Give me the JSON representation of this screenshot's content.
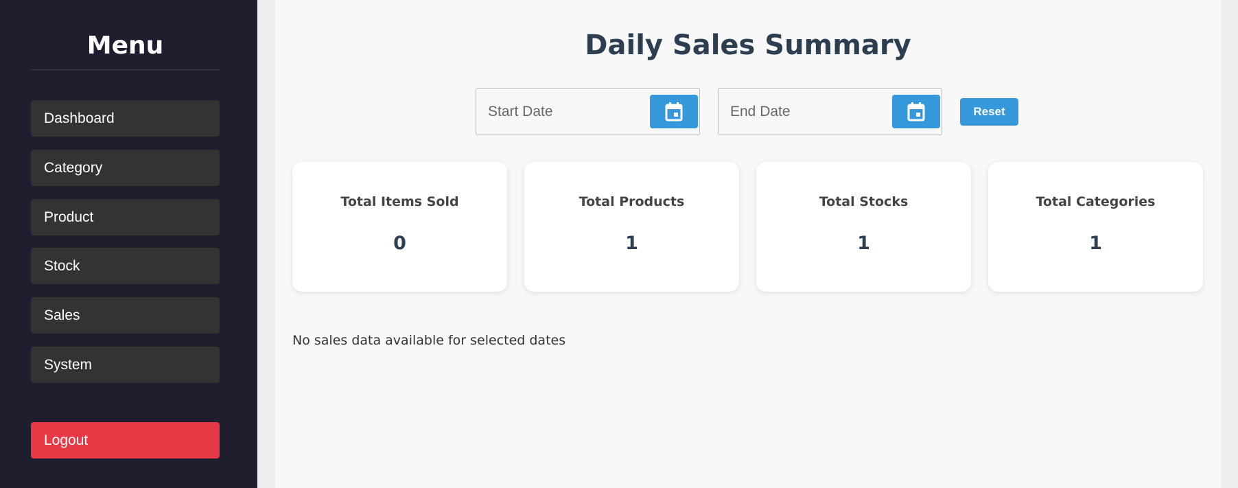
{
  "sidebar": {
    "title": "Menu",
    "items": [
      {
        "label": "Dashboard"
      },
      {
        "label": "Category"
      },
      {
        "label": "Product"
      },
      {
        "label": "Stock"
      },
      {
        "label": "Sales"
      },
      {
        "label": "System"
      }
    ],
    "logout_label": "Logout"
  },
  "main": {
    "title": "Daily Sales Summary",
    "start_date": {
      "placeholder": "Start Date",
      "icon": "calendar-icon"
    },
    "end_date": {
      "placeholder": "End Date",
      "icon": "calendar-icon"
    },
    "reset_label": "Reset",
    "cards": [
      {
        "label": "Total Items Sold",
        "value": "0"
      },
      {
        "label": "Total Products",
        "value": "1"
      },
      {
        "label": "Total Stocks",
        "value": "1"
      },
      {
        "label": "Total Categories",
        "value": "1"
      }
    ],
    "empty_message": "No sales data available for selected dates"
  },
  "colors": {
    "sidebar_bg": "#1e1e2e",
    "nav_item_bg": "#333333",
    "logout_bg": "#e63946",
    "accent": "#3498db",
    "title_color": "#2c3e50"
  }
}
